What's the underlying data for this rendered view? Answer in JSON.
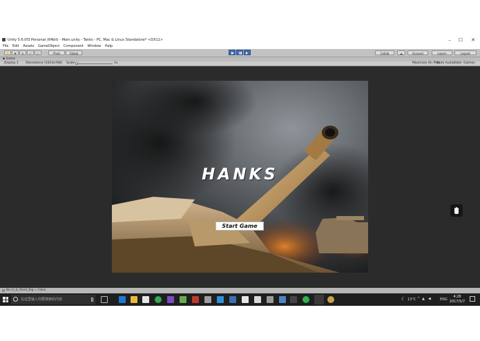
{
  "window": {
    "title": "Unity 5.6.0f3 Personal (64bit) - Main.unity - Tanks - PC, Mac & Linux Standalone* <DX11>",
    "minimize": "–",
    "maximize": "☐",
    "close": "✕"
  },
  "menu": [
    "File",
    "Edit",
    "Assets",
    "GameObject",
    "Component",
    "Window",
    "Help"
  ],
  "toolbar": {
    "pivot": "Pivot",
    "global": "Global",
    "collab": "Collab",
    "account": "Account",
    "layers": "Layers",
    "layout": "Layout"
  },
  "game_tab": {
    "label": "Game",
    "display": "Display 1",
    "resolution": "Standalone (1024x768)",
    "scale_label": "Scale",
    "scale_value": "1x",
    "maximize_on_play": "Maximize On Play",
    "mute_audio": "Mute Audio",
    "stats": "Stats",
    "gizmos": "Gizmos"
  },
  "game": {
    "title": "HANKS",
    "start_button": "Start Game"
  },
  "status": {
    "message": "Bo m_b_Shell_Big = False"
  },
  "taskbar": {
    "search_placeholder": "在这里输入你要搜索的内容",
    "temperature": "13°C",
    "language": "ENG",
    "time": "4:28",
    "date": "2017/5/7"
  },
  "colors": {
    "play_active": "#3f6fb3",
    "editor_bg": "#2b2b2b",
    "taskbar_bg": "#1f1f1f"
  }
}
